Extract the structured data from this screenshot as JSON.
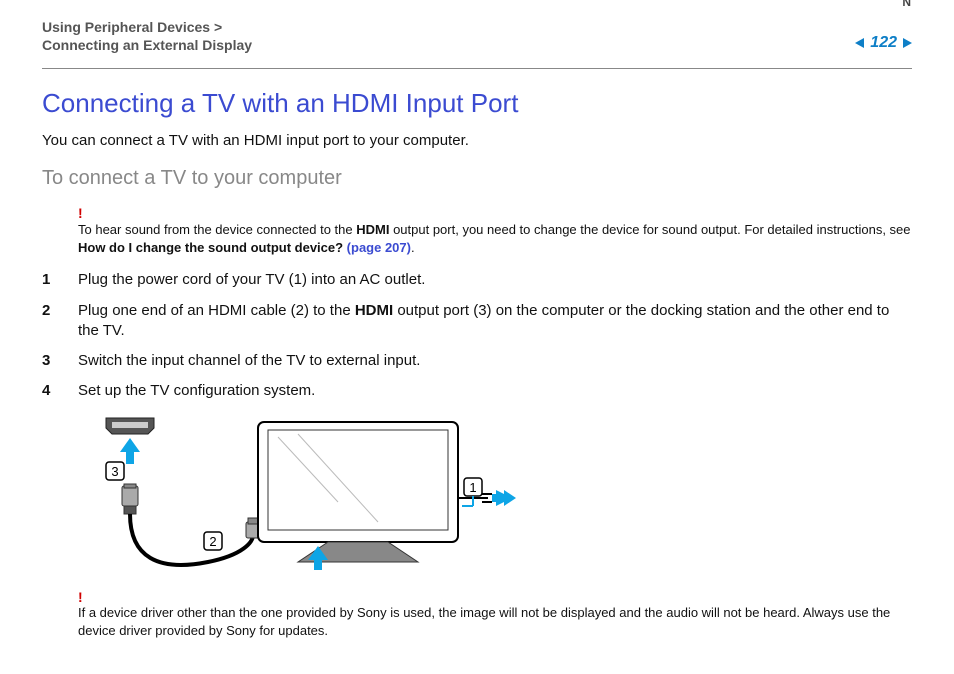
{
  "header": {
    "n_label": "N",
    "breadcrumb_line1": "Using Peripheral Devices >",
    "breadcrumb_line2": "Connecting an External Display",
    "page_number": "122"
  },
  "title": "Connecting a TV with an HDMI Input Port",
  "intro": "You can connect a TV with an HDMI input port to your computer.",
  "subtitle": "To connect a TV to your computer",
  "note1": {
    "bang": "!",
    "pre": "To hear sound from the device connected to the ",
    "bold1": "HDMI",
    "mid": " output port, you need to change the device for sound output. For detailed instructions, see ",
    "bold2": "How do I change the sound output device? ",
    "link": "(page 207)",
    "post": "."
  },
  "steps": [
    {
      "num": "1",
      "pre": "Plug the power cord of your TV (1) into an AC outlet.",
      "bold": "",
      "post": ""
    },
    {
      "num": "2",
      "pre": "Plug one end of an HDMI cable (2) to the ",
      "bold": "HDMI",
      "post": " output port (3) on the computer or the docking station and the other end to the TV."
    },
    {
      "num": "3",
      "pre": "Switch the input channel of the TV to external input.",
      "bold": "",
      "post": ""
    },
    {
      "num": "4",
      "pre": "Set up the TV configuration system.",
      "bold": "",
      "post": ""
    }
  ],
  "figure": {
    "callout_1": "1",
    "callout_2": "2",
    "callout_3": "3"
  },
  "note2": {
    "bang": "!",
    "text": "If a device driver other than the one provided by Sony is used, the image will not be displayed and the audio will not be heard. Always use the device driver provided by Sony for updates."
  }
}
